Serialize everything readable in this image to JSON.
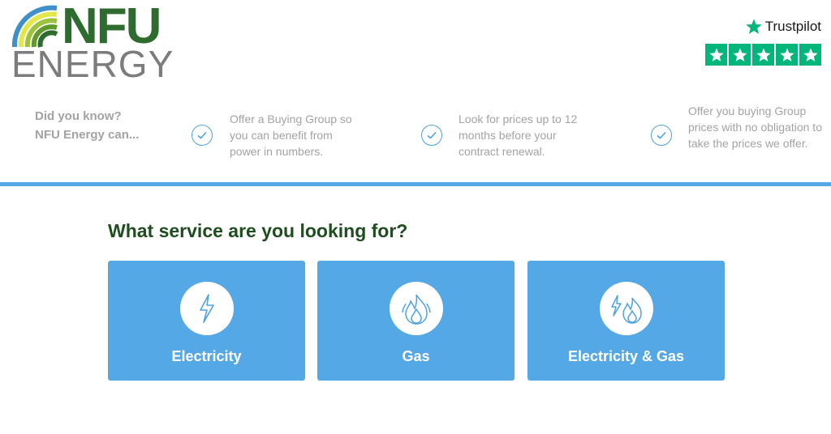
{
  "brand": {
    "logo_nfu": "NFU",
    "logo_energy": "ENERGY",
    "logo_colors": [
      "#2e6b2e",
      "#5f9a2a",
      "#9bc43c",
      "#e2e84a",
      "#3f8fc9"
    ]
  },
  "trustpilot": {
    "name": "Trustpilot",
    "rating_stars": 5,
    "color": "#00b67a"
  },
  "benefits": {
    "intro": "Did you know? NFU Energy can...",
    "items": [
      {
        "icon": "check-circle-icon",
        "text": "Offer a Buying Group so you can benefit from power in numbers."
      },
      {
        "icon": "check-circle-icon",
        "text": "Look for prices up to 12 months before your contract renewal."
      },
      {
        "icon": "check-circle-icon",
        "text": "Offer you buying Group prices with no obligation to take the prices we offer."
      }
    ]
  },
  "services": {
    "heading": "What service are you looking for?",
    "accent_color": "#55a8e6",
    "cards": [
      {
        "label": "Electricity",
        "icon": "lightning-icon"
      },
      {
        "label": "Gas",
        "icon": "flame-icon"
      },
      {
        "label": "Electricity & Gas",
        "icon": "lightning-flame-icon"
      }
    ]
  }
}
